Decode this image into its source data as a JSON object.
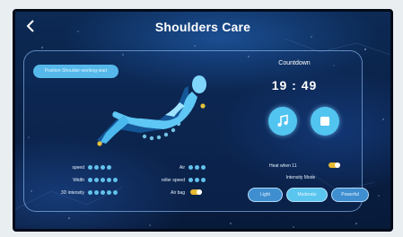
{
  "header": {
    "title": "Shoulders Care"
  },
  "status_pill": "Position-Shoulder-working-start",
  "countdown": {
    "label": "Countdown",
    "time": "19 : 49"
  },
  "settings": {
    "left": [
      {
        "label": "speed",
        "level": 4
      },
      {
        "label": "Width",
        "level": 5
      },
      {
        "label": "3D intensity",
        "level": 5
      }
    ],
    "middle": [
      {
        "label": "Air",
        "level": 3
      },
      {
        "label": "roller speed",
        "level": 3
      },
      {
        "label": "Air bag",
        "toggle": true
      }
    ]
  },
  "heat": {
    "label": "Heat when 11",
    "on": true
  },
  "intensity": {
    "label": "Intensity Mode",
    "options": [
      "Light",
      "Moderate",
      "Powerful"
    ],
    "selected": "Moderate"
  },
  "colors": {
    "accent": "#56b8ea",
    "toggle": "#e6b830",
    "background": "#0a2248"
  }
}
